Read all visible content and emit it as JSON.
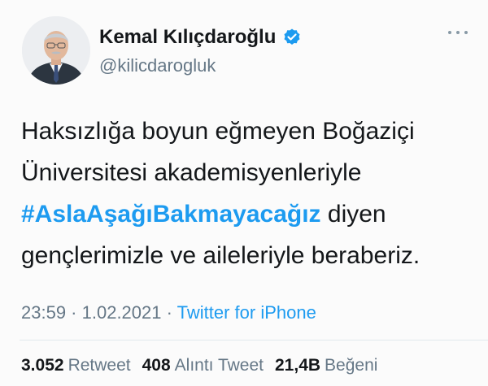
{
  "author": {
    "display_name": "Kemal Kılıçdaroğlu",
    "handle": "@kilicdarogluk",
    "verified_icon": "verified-badge-icon",
    "avatar_alt": "profile-photo"
  },
  "tweet": {
    "line1": "Haksızlığa boyun eğmeyen Boğaziçi",
    "line2": "Üniversitesi akademisyenleriyle",
    "hashtag": "#AslaAşağıBakmayacağız",
    "line3_rest": " diyen",
    "line4": "gençlerimizle ve aileleriyle beraberiz."
  },
  "meta": {
    "time": "23:59",
    "separator1": " · ",
    "date": "1.02.2021",
    "separator2": " · ",
    "source": "Twitter for iPhone"
  },
  "stats": {
    "retweets_count": "3.052",
    "retweets_label": "Retweet",
    "quotes_count": "408",
    "quotes_label": "Alıntı Tweet",
    "likes_count": "21,4B",
    "likes_label": "Beğeni"
  },
  "colors": {
    "accent": "#1d9bf0",
    "secondary_text": "#657786",
    "primary_text": "#14171a"
  }
}
